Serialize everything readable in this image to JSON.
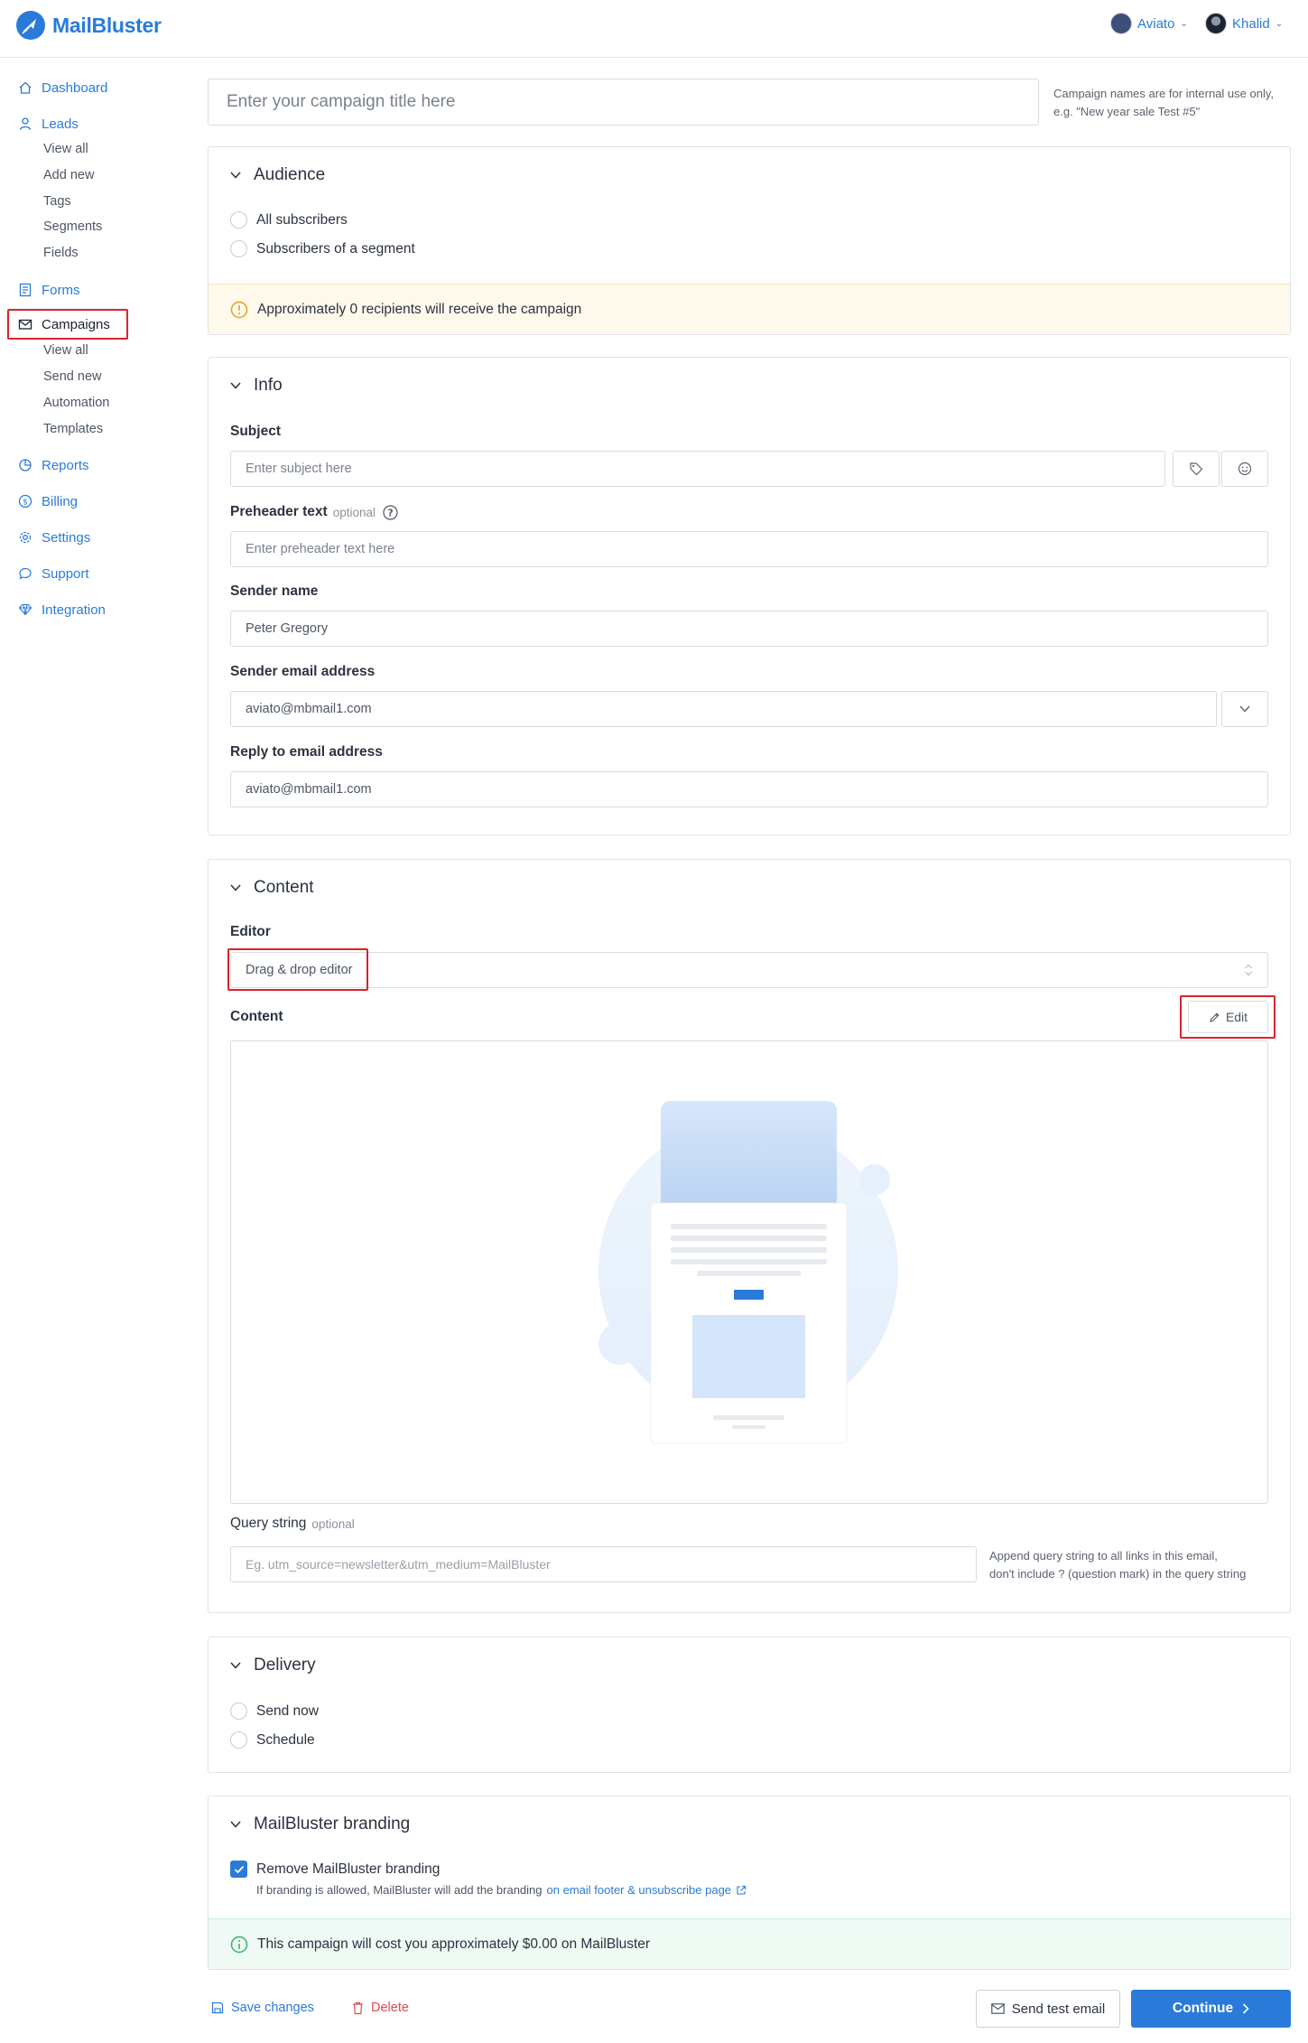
{
  "app": {
    "brand": "MailBluster",
    "accounts": [
      {
        "name": "Aviato"
      },
      {
        "name": "Khalid"
      }
    ]
  },
  "sidebar": {
    "items": [
      {
        "label": "Dashboard",
        "icon": "home-icon"
      },
      {
        "label": "Leads",
        "icon": "user-icon",
        "children": [
          "View all",
          "Add new",
          "Tags",
          "Segments",
          "Fields"
        ]
      },
      {
        "label": "Forms",
        "icon": "form-icon"
      },
      {
        "label": "Campaigns",
        "icon": "mail-icon",
        "children": [
          "View all",
          "Send new",
          "Automation",
          "Templates"
        ]
      },
      {
        "label": "Reports",
        "icon": "chart-icon"
      },
      {
        "label": "Billing",
        "icon": "dollar-icon"
      },
      {
        "label": "Settings",
        "icon": "gear-icon"
      },
      {
        "label": "Support",
        "icon": "chat-icon"
      },
      {
        "label": "Integration",
        "icon": "diamond-icon"
      }
    ],
    "active": "Campaigns"
  },
  "campaign": {
    "title_placeholder": "Enter your campaign title here",
    "title_hint_line1": "Campaign names are for internal use only,",
    "title_hint_line2": "e.g. \"New year sale Test #5\""
  },
  "audience": {
    "title": "Audience",
    "options": [
      "All subscribers",
      "Subscribers of a segment"
    ],
    "notice": "Approximately 0 recipients will receive the campaign"
  },
  "info": {
    "title": "Info",
    "subject_label": "Subject",
    "subject_placeholder": "Enter subject here",
    "preheader_label": "Preheader text",
    "preheader_optional": "optional",
    "preheader_placeholder": "Enter preheader text here",
    "sender_name_label": "Sender name",
    "sender_name_value": "Peter Gregory",
    "sender_email_label": "Sender email address",
    "sender_email_value": "aviato@mbmail1.com",
    "reply_label": "Reply to email address",
    "reply_value": "aviato@mbmail1.com"
  },
  "content": {
    "title": "Content",
    "editor_label": "Editor",
    "editor_value": "Drag & drop editor",
    "content_label": "Content",
    "edit_label": "Edit",
    "query_label": "Query string",
    "query_optional": "optional",
    "query_placeholder": "Eg. utm_source=newsletter&utm_medium=MailBluster",
    "query_hint_line1": "Append query string to all links in this email,",
    "query_hint_line2": "don't include ? (question mark) in the query string"
  },
  "delivery": {
    "title": "Delivery",
    "options": [
      "Send now",
      "Schedule"
    ]
  },
  "branding": {
    "title": "MailBluster branding",
    "checkbox_label": "Remove MailBluster branding",
    "desc_prefix": "If branding is allowed, MailBluster will add the branding",
    "desc_link": "on email footer & unsubscribe page",
    "cost_notice": "This campaign will cost you approximately $0.00 on MailBluster"
  },
  "actions": {
    "save": "Save changes",
    "delete": "Delete",
    "send_test": "Send test email",
    "continue": "Continue"
  },
  "colors": {
    "accent": "#2a7bd9",
    "danger": "#e34b4b",
    "highlight": "#d9232d"
  }
}
